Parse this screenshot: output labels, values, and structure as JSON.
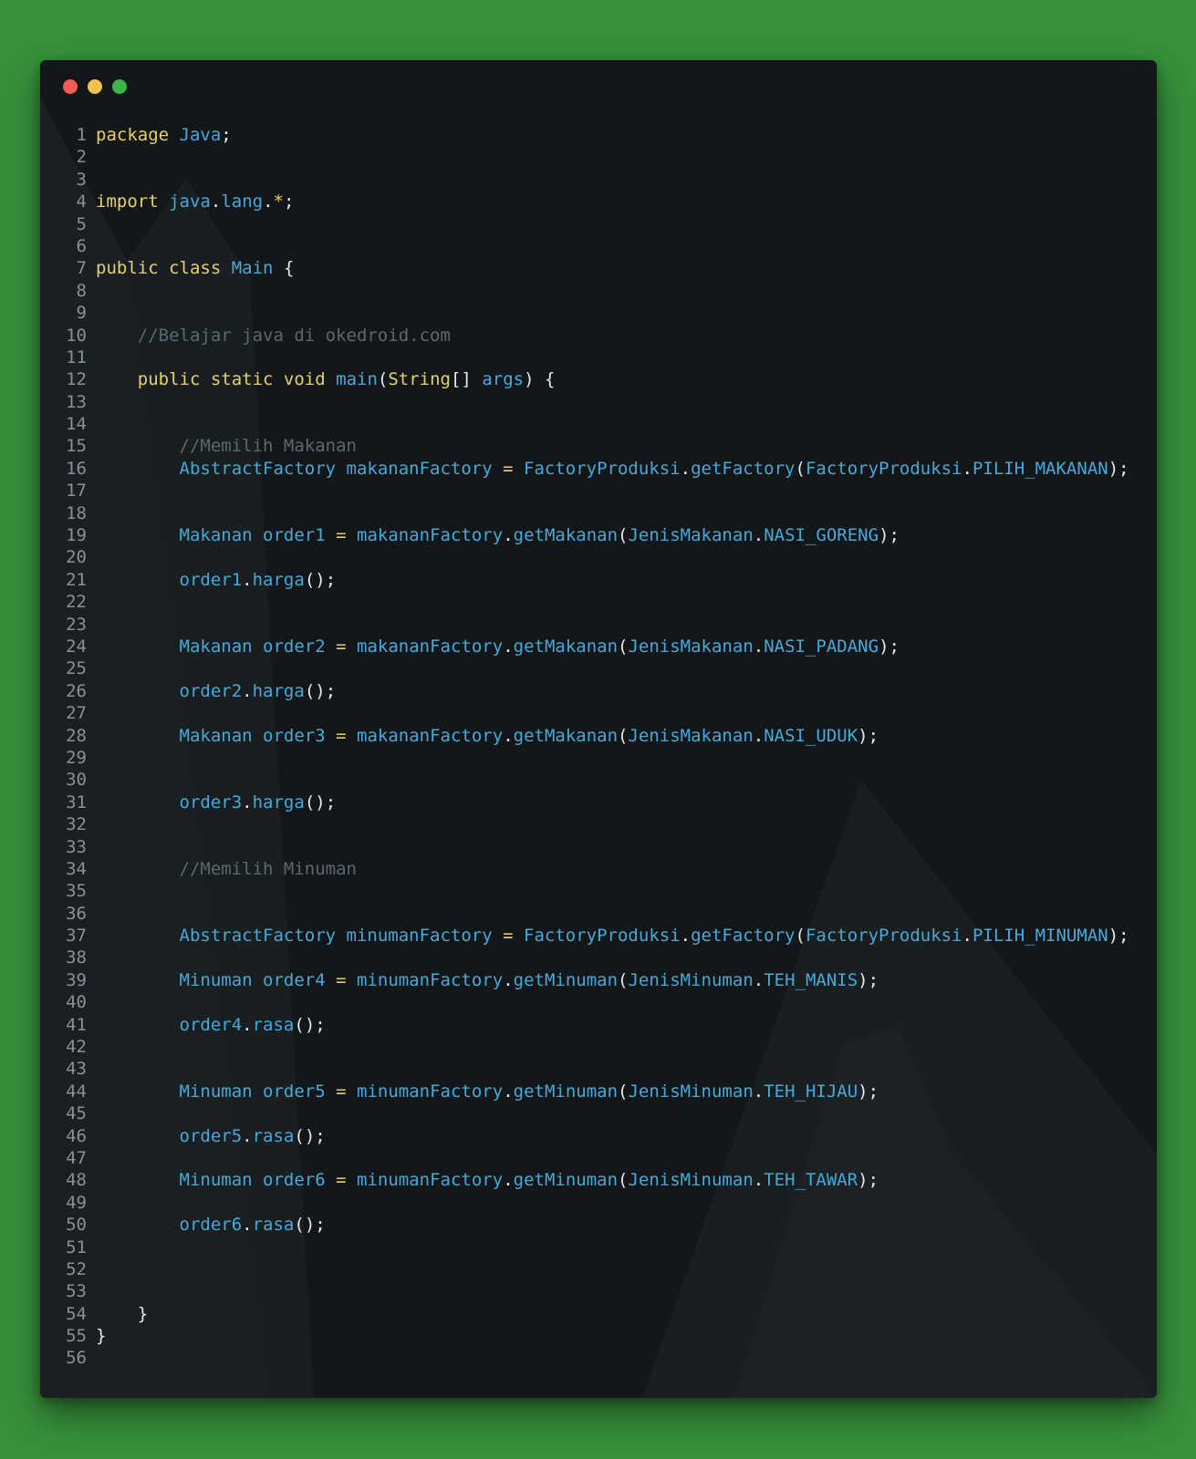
{
  "window": {
    "controls": [
      "close",
      "minimize",
      "maximize"
    ],
    "colors": {
      "close": "#f25c54",
      "minimize": "#f2c14e",
      "maximize": "#3cb54a"
    }
  },
  "colors": {
    "background": "#37913b",
    "editor": "#14171a",
    "keyword": "#e6d06a",
    "identifier": "#46a9d9",
    "comment": "#5d6770",
    "punctuation": "#e8e8e8",
    "line_number": "#8a9099"
  },
  "lines": [
    {
      "n": "1",
      "tokens": [
        {
          "t": "kw",
          "v": "package"
        },
        {
          "t": "pn",
          "v": " "
        },
        {
          "t": "id",
          "v": "Java"
        },
        {
          "t": "pn",
          "v": ";"
        }
      ]
    },
    {
      "n": "2",
      "tokens": []
    },
    {
      "n": "3",
      "tokens": []
    },
    {
      "n": "4",
      "tokens": [
        {
          "t": "kw",
          "v": "import"
        },
        {
          "t": "pn",
          "v": " "
        },
        {
          "t": "id",
          "v": "java"
        },
        {
          "t": "pn",
          "v": "."
        },
        {
          "t": "id",
          "v": "lang"
        },
        {
          "t": "pn",
          "v": "."
        },
        {
          "t": "kw",
          "v": "*"
        },
        {
          "t": "pn",
          "v": ";"
        }
      ]
    },
    {
      "n": "5",
      "tokens": []
    },
    {
      "n": "6",
      "tokens": []
    },
    {
      "n": "7",
      "tokens": [
        {
          "t": "kw",
          "v": "public class"
        },
        {
          "t": "pn",
          "v": " "
        },
        {
          "t": "id",
          "v": "Main"
        },
        {
          "t": "pn",
          "v": " {"
        }
      ]
    },
    {
      "n": "8",
      "tokens": []
    },
    {
      "n": "9",
      "tokens": []
    },
    {
      "n": "10",
      "tokens": [
        {
          "t": "pn",
          "v": "    "
        },
        {
          "t": "cm",
          "v": "//Belajar java di okedroid.com"
        }
      ]
    },
    {
      "n": "11",
      "tokens": []
    },
    {
      "n": "12",
      "tokens": [
        {
          "t": "pn",
          "v": "    "
        },
        {
          "t": "kw",
          "v": "public static void"
        },
        {
          "t": "pn",
          "v": " "
        },
        {
          "t": "id",
          "v": "main"
        },
        {
          "t": "pn",
          "v": "("
        },
        {
          "t": "kw",
          "v": "String"
        },
        {
          "t": "pn",
          "v": "[] "
        },
        {
          "t": "id",
          "v": "args"
        },
        {
          "t": "pn",
          "v": ") {"
        }
      ]
    },
    {
      "n": "13",
      "tokens": []
    },
    {
      "n": "14",
      "tokens": []
    },
    {
      "n": "15",
      "tokens": [
        {
          "t": "pn",
          "v": "        "
        },
        {
          "t": "cm",
          "v": "//Memilih Makanan"
        }
      ]
    },
    {
      "n": "16",
      "tokens": [
        {
          "t": "pn",
          "v": "        "
        },
        {
          "t": "id",
          "v": "AbstractFactory makananFactory"
        },
        {
          "t": "pn",
          "v": " "
        },
        {
          "t": "kw",
          "v": "="
        },
        {
          "t": "pn",
          "v": " "
        },
        {
          "t": "id",
          "v": "FactoryProduksi"
        },
        {
          "t": "pn",
          "v": "."
        },
        {
          "t": "id",
          "v": "getFactory"
        },
        {
          "t": "pn",
          "v": "("
        },
        {
          "t": "id",
          "v": "FactoryProduksi"
        },
        {
          "t": "pn",
          "v": "."
        },
        {
          "t": "id",
          "v": "PILIH_MAKANAN"
        },
        {
          "t": "pn",
          "v": ");"
        }
      ]
    },
    {
      "n": "17",
      "tokens": []
    },
    {
      "n": "18",
      "tokens": []
    },
    {
      "n": "19",
      "tokens": [
        {
          "t": "pn",
          "v": "        "
        },
        {
          "t": "id",
          "v": "Makanan order1"
        },
        {
          "t": "pn",
          "v": " "
        },
        {
          "t": "kw",
          "v": "="
        },
        {
          "t": "pn",
          "v": " "
        },
        {
          "t": "id",
          "v": "makananFactory"
        },
        {
          "t": "pn",
          "v": "."
        },
        {
          "t": "id",
          "v": "getMakanan"
        },
        {
          "t": "pn",
          "v": "("
        },
        {
          "t": "id",
          "v": "JenisMakanan"
        },
        {
          "t": "pn",
          "v": "."
        },
        {
          "t": "id",
          "v": "NASI_GORENG"
        },
        {
          "t": "pn",
          "v": ");"
        }
      ]
    },
    {
      "n": "20",
      "tokens": []
    },
    {
      "n": "21",
      "tokens": [
        {
          "t": "pn",
          "v": "        "
        },
        {
          "t": "id",
          "v": "order1"
        },
        {
          "t": "pn",
          "v": "."
        },
        {
          "t": "id",
          "v": "harga"
        },
        {
          "t": "pn",
          "v": "();"
        }
      ]
    },
    {
      "n": "22",
      "tokens": []
    },
    {
      "n": "23",
      "tokens": []
    },
    {
      "n": "24",
      "tokens": [
        {
          "t": "pn",
          "v": "        "
        },
        {
          "t": "id",
          "v": "Makanan order2"
        },
        {
          "t": "pn",
          "v": " "
        },
        {
          "t": "kw",
          "v": "="
        },
        {
          "t": "pn",
          "v": " "
        },
        {
          "t": "id",
          "v": "makananFactory"
        },
        {
          "t": "pn",
          "v": "."
        },
        {
          "t": "id",
          "v": "getMakanan"
        },
        {
          "t": "pn",
          "v": "("
        },
        {
          "t": "id",
          "v": "JenisMakanan"
        },
        {
          "t": "pn",
          "v": "."
        },
        {
          "t": "id",
          "v": "NASI_PADANG"
        },
        {
          "t": "pn",
          "v": ");"
        }
      ]
    },
    {
      "n": "25",
      "tokens": []
    },
    {
      "n": "26",
      "tokens": [
        {
          "t": "pn",
          "v": "        "
        },
        {
          "t": "id",
          "v": "order2"
        },
        {
          "t": "pn",
          "v": "."
        },
        {
          "t": "id",
          "v": "harga"
        },
        {
          "t": "pn",
          "v": "();"
        }
      ]
    },
    {
      "n": "27",
      "tokens": []
    },
    {
      "n": "28",
      "tokens": [
        {
          "t": "pn",
          "v": "        "
        },
        {
          "t": "id",
          "v": "Makanan order3"
        },
        {
          "t": "pn",
          "v": " "
        },
        {
          "t": "kw",
          "v": "="
        },
        {
          "t": "pn",
          "v": " "
        },
        {
          "t": "id",
          "v": "makananFactory"
        },
        {
          "t": "pn",
          "v": "."
        },
        {
          "t": "id",
          "v": "getMakanan"
        },
        {
          "t": "pn",
          "v": "("
        },
        {
          "t": "id",
          "v": "JenisMakanan"
        },
        {
          "t": "pn",
          "v": "."
        },
        {
          "t": "id",
          "v": "NASI_UDUK"
        },
        {
          "t": "pn",
          "v": ");"
        }
      ]
    },
    {
      "n": "29",
      "tokens": []
    },
    {
      "n": "30",
      "tokens": []
    },
    {
      "n": "31",
      "tokens": [
        {
          "t": "pn",
          "v": "        "
        },
        {
          "t": "id",
          "v": "order3"
        },
        {
          "t": "pn",
          "v": "."
        },
        {
          "t": "id",
          "v": "harga"
        },
        {
          "t": "pn",
          "v": "();"
        }
      ]
    },
    {
      "n": "32",
      "tokens": []
    },
    {
      "n": "33",
      "tokens": []
    },
    {
      "n": "34",
      "tokens": [
        {
          "t": "pn",
          "v": "        "
        },
        {
          "t": "cm",
          "v": "//Memilih Minuman"
        }
      ]
    },
    {
      "n": "35",
      "tokens": []
    },
    {
      "n": "36",
      "tokens": []
    },
    {
      "n": "37",
      "tokens": [
        {
          "t": "pn",
          "v": "        "
        },
        {
          "t": "id",
          "v": "AbstractFactory minumanFactory"
        },
        {
          "t": "pn",
          "v": " "
        },
        {
          "t": "kw",
          "v": "="
        },
        {
          "t": "pn",
          "v": " "
        },
        {
          "t": "id",
          "v": "FactoryProduksi"
        },
        {
          "t": "pn",
          "v": "."
        },
        {
          "t": "id",
          "v": "getFactory"
        },
        {
          "t": "pn",
          "v": "("
        },
        {
          "t": "id",
          "v": "FactoryProduksi"
        },
        {
          "t": "pn",
          "v": "."
        },
        {
          "t": "id",
          "v": "PILIH_MINUMAN"
        },
        {
          "t": "pn",
          "v": ");"
        }
      ]
    },
    {
      "n": "38",
      "tokens": []
    },
    {
      "n": "39",
      "tokens": [
        {
          "t": "pn",
          "v": "        "
        },
        {
          "t": "id",
          "v": "Minuman order4"
        },
        {
          "t": "pn",
          "v": " "
        },
        {
          "t": "kw",
          "v": "="
        },
        {
          "t": "pn",
          "v": " "
        },
        {
          "t": "id",
          "v": "minumanFactory"
        },
        {
          "t": "pn",
          "v": "."
        },
        {
          "t": "id",
          "v": "getMinuman"
        },
        {
          "t": "pn",
          "v": "("
        },
        {
          "t": "id",
          "v": "JenisMinuman"
        },
        {
          "t": "pn",
          "v": "."
        },
        {
          "t": "id",
          "v": "TEH_MANIS"
        },
        {
          "t": "pn",
          "v": ");"
        }
      ]
    },
    {
      "n": "40",
      "tokens": []
    },
    {
      "n": "41",
      "tokens": [
        {
          "t": "pn",
          "v": "        "
        },
        {
          "t": "id",
          "v": "order4"
        },
        {
          "t": "pn",
          "v": "."
        },
        {
          "t": "id",
          "v": "rasa"
        },
        {
          "t": "pn",
          "v": "();"
        }
      ]
    },
    {
      "n": "42",
      "tokens": []
    },
    {
      "n": "43",
      "tokens": []
    },
    {
      "n": "44",
      "tokens": [
        {
          "t": "pn",
          "v": "        "
        },
        {
          "t": "id",
          "v": "Minuman order5"
        },
        {
          "t": "pn",
          "v": " "
        },
        {
          "t": "kw",
          "v": "="
        },
        {
          "t": "pn",
          "v": " "
        },
        {
          "t": "id",
          "v": "minumanFactory"
        },
        {
          "t": "pn",
          "v": "."
        },
        {
          "t": "id",
          "v": "getMinuman"
        },
        {
          "t": "pn",
          "v": "("
        },
        {
          "t": "id",
          "v": "JenisMinuman"
        },
        {
          "t": "pn",
          "v": "."
        },
        {
          "t": "id",
          "v": "TEH_HIJAU"
        },
        {
          "t": "pn",
          "v": ");"
        }
      ]
    },
    {
      "n": "45",
      "tokens": []
    },
    {
      "n": "46",
      "tokens": [
        {
          "t": "pn",
          "v": "        "
        },
        {
          "t": "id",
          "v": "order5"
        },
        {
          "t": "pn",
          "v": "."
        },
        {
          "t": "id",
          "v": "rasa"
        },
        {
          "t": "pn",
          "v": "();"
        }
      ]
    },
    {
      "n": "47",
      "tokens": []
    },
    {
      "n": "48",
      "tokens": [
        {
          "t": "pn",
          "v": "        "
        },
        {
          "t": "id",
          "v": "Minuman order6"
        },
        {
          "t": "pn",
          "v": " "
        },
        {
          "t": "kw",
          "v": "="
        },
        {
          "t": "pn",
          "v": " "
        },
        {
          "t": "id",
          "v": "minumanFactory"
        },
        {
          "t": "pn",
          "v": "."
        },
        {
          "t": "id",
          "v": "getMinuman"
        },
        {
          "t": "pn",
          "v": "("
        },
        {
          "t": "id",
          "v": "JenisMinuman"
        },
        {
          "t": "pn",
          "v": "."
        },
        {
          "t": "id",
          "v": "TEH_TAWAR"
        },
        {
          "t": "pn",
          "v": ");"
        }
      ]
    },
    {
      "n": "49",
      "tokens": []
    },
    {
      "n": "50",
      "tokens": [
        {
          "t": "pn",
          "v": "        "
        },
        {
          "t": "id",
          "v": "order6"
        },
        {
          "t": "pn",
          "v": "."
        },
        {
          "t": "id",
          "v": "rasa"
        },
        {
          "t": "pn",
          "v": "();"
        }
      ]
    },
    {
      "n": "51",
      "tokens": []
    },
    {
      "n": "52",
      "tokens": []
    },
    {
      "n": "53",
      "tokens": []
    },
    {
      "n": "54",
      "tokens": [
        {
          "t": "pn",
          "v": "    }"
        }
      ]
    },
    {
      "n": "55",
      "tokens": [
        {
          "t": "pn",
          "v": "}"
        }
      ]
    },
    {
      "n": "56",
      "tokens": []
    }
  ]
}
